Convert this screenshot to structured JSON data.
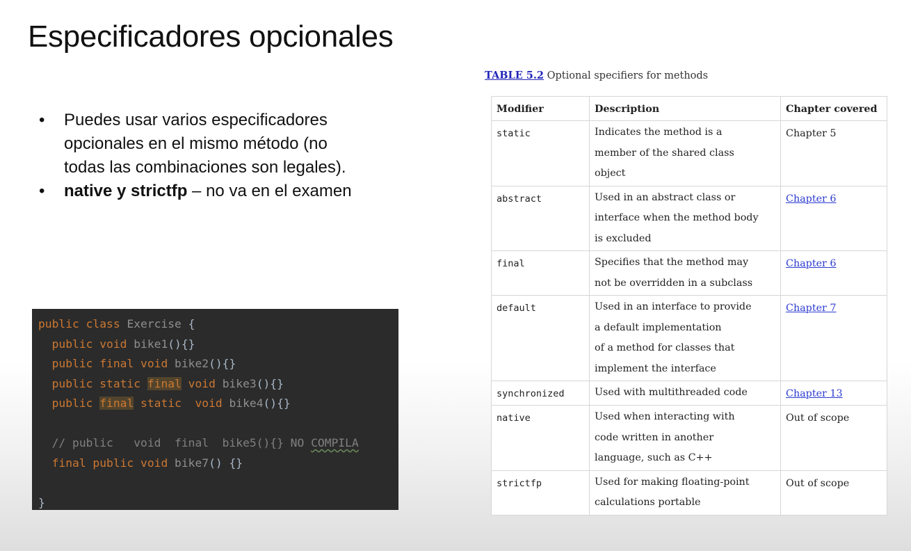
{
  "slide": {
    "title": "Especificadores opcionales",
    "bullets": [
      {
        "bold": "",
        "text": "Puedes usar varios especificadores opcionales en el mismo método (no todas las combinaciones son legales)."
      },
      {
        "bold": "native y strictfp",
        "text": " – no va en el examen"
      }
    ]
  },
  "code": {
    "lines": [
      [
        {
          "t": "public class ",
          "c": "kw"
        },
        {
          "t": "Exercise",
          "c": "id"
        },
        {
          "t": " {",
          "c": "pl"
        }
      ],
      [
        {
          "t": "  public void ",
          "c": "kw"
        },
        {
          "t": "bike1",
          "c": "id"
        },
        {
          "t": "(){}",
          "c": "pl"
        }
      ],
      [
        {
          "t": "  public final void ",
          "c": "kw"
        },
        {
          "t": "bike2",
          "c": "id"
        },
        {
          "t": "(){}",
          "c": "pl"
        }
      ],
      [
        {
          "t": "  public static ",
          "c": "kw"
        },
        {
          "t": "final",
          "c": "kw hl"
        },
        {
          "t": " void ",
          "c": "kw"
        },
        {
          "t": "bike3",
          "c": "id"
        },
        {
          "t": "(){}",
          "c": "pl"
        }
      ],
      [
        {
          "t": "  public ",
          "c": "kw"
        },
        {
          "t": "final",
          "c": "kw hl"
        },
        {
          "t": " static  void ",
          "c": "kw"
        },
        {
          "t": "bike4",
          "c": "id"
        },
        {
          "t": "(){}",
          "c": "pl"
        }
      ],
      [
        {
          "t": "",
          "c": "pl"
        }
      ],
      [
        {
          "t": "  // public   void  final  bike5(){} NO ",
          "c": "cm"
        },
        {
          "t": "COMPILA",
          "c": "cm sq"
        }
      ],
      [
        {
          "t": "  final public void ",
          "c": "kw"
        },
        {
          "t": "bike7",
          "c": "id"
        },
        {
          "t": "() {}",
          "c": "pl"
        }
      ],
      [
        {
          "t": "",
          "c": "pl"
        }
      ],
      [
        {
          "t": "}",
          "c": "pl"
        }
      ]
    ]
  },
  "table": {
    "caption_label": "TABLE 5.2",
    "caption_text": " Optional specifiers for methods",
    "headers": {
      "modifier": "Modifier",
      "description": "Description",
      "chapter": "Chapter covered"
    },
    "rows": [
      {
        "modifier": "static",
        "description": [
          "Indicates the method is a",
          "member of the shared class",
          "object"
        ],
        "chapter": "Chapter 5",
        "link": false
      },
      {
        "modifier": "abstract",
        "description": [
          "Used in an abstract class or",
          "interface when the method body",
          "is excluded"
        ],
        "chapter": "Chapter 6",
        "link": true
      },
      {
        "modifier": "final",
        "description": [
          "Specifies that the method may",
          "not be overridden in a subclass"
        ],
        "chapter": "Chapter 6",
        "link": true
      },
      {
        "modifier": "default",
        "description": [
          "Used in an interface to provide",
          "a default implementation",
          "of a method for classes that",
          "implement the interface"
        ],
        "chapter": "Chapter 7",
        "link": true
      },
      {
        "modifier": "synchronized",
        "description": [
          "Used with multithreaded code"
        ],
        "chapter": "Chapter 13",
        "link": true
      },
      {
        "modifier": "native",
        "description": [
          "Used when interacting with",
          "code written in another",
          "language, such as C++"
        ],
        "chapter": "Out of scope",
        "link": false
      },
      {
        "modifier": "strictfp",
        "description": [
          "Used for making floating-point",
          "calculations portable"
        ],
        "chapter": "Out of scope",
        "link": false
      }
    ]
  }
}
